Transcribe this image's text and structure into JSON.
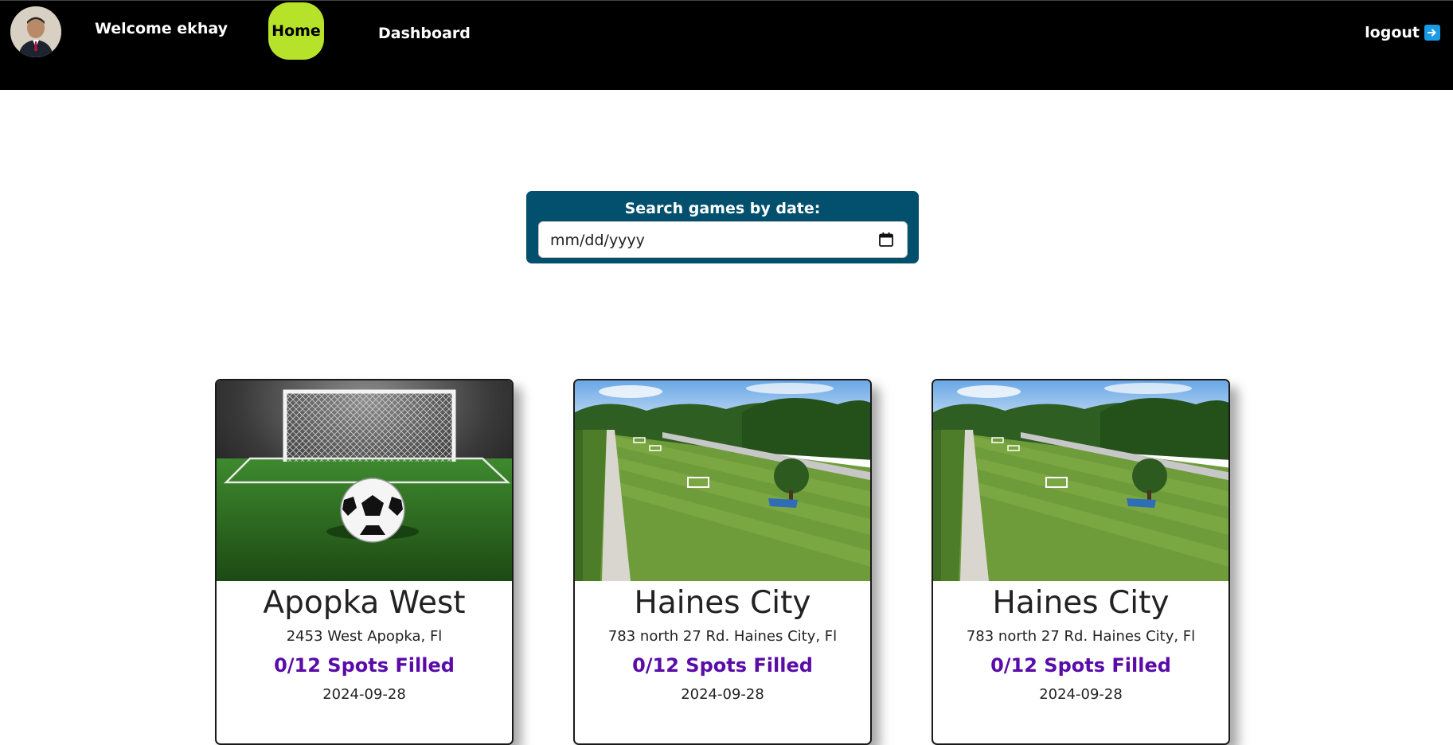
{
  "nav": {
    "welcome_text": "Welcome ekhay",
    "home_label": "Home",
    "dashboard_label": "Dashboard",
    "logout_label": "logout",
    "logout_icon": "right-arrow-icon",
    "home_active_color": "#b7e22a",
    "background_color": "#000000"
  },
  "search": {
    "label": "Search games by date:",
    "date_placeholder": "mm/dd/yyyy",
    "calendar_icon": "calendar-icon",
    "background_color": "#034f6e"
  },
  "games": [
    {
      "title": "Apopka West",
      "address": "2453 West Apopka, Fl",
      "spots": "0/12 Spots Filled",
      "date": "2024-09-28",
      "image": "soccer-ball-goal-image"
    },
    {
      "title": "Haines City",
      "address": "783 north 27 Rd. Haines City, Fl",
      "spots": "0/12 Spots Filled",
      "date": "2024-09-28",
      "image": "soccer-field-aerial-image"
    },
    {
      "title": "Haines City",
      "address": "783 north 27 Rd. Haines City, Fl",
      "spots": "0/12 Spots Filled",
      "date": "2024-09-28",
      "image": "soccer-field-aerial-image"
    }
  ],
  "colors": {
    "spots_text": "#5a0ba8"
  }
}
